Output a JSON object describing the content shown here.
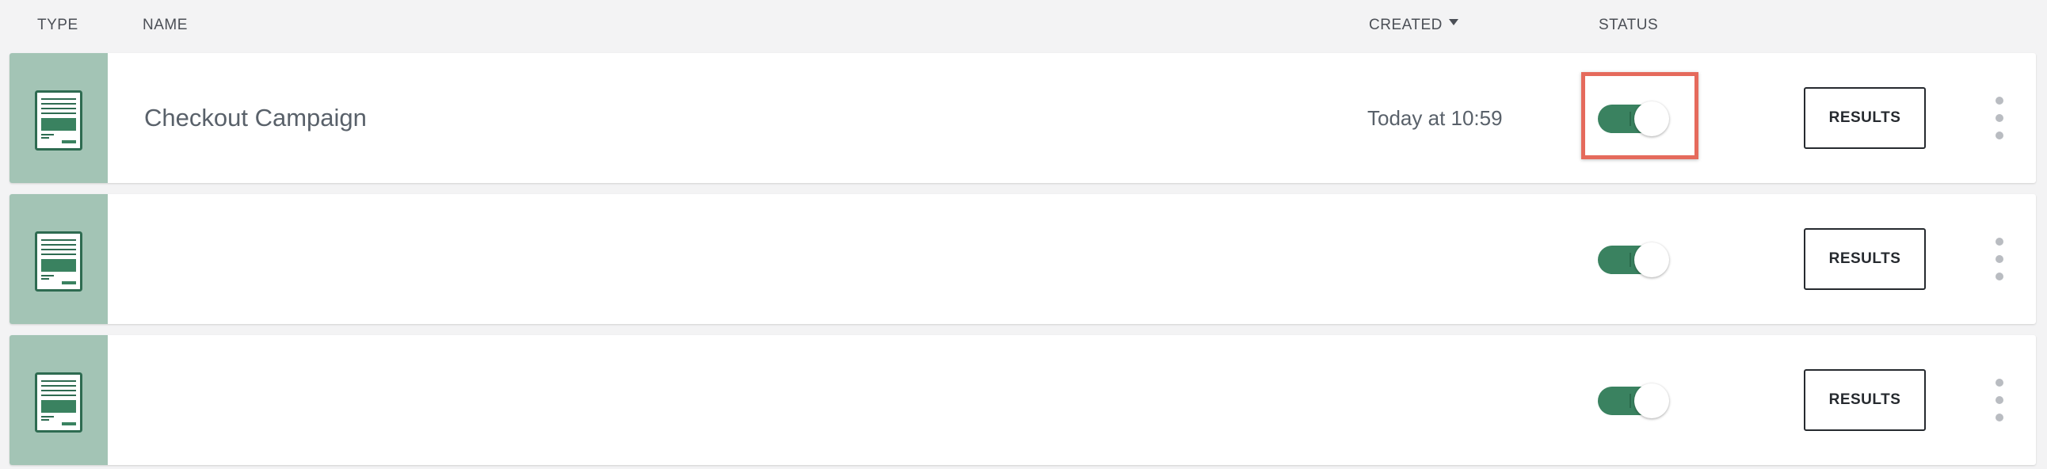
{
  "header": {
    "type_label": "TYPE",
    "name_label": "NAME",
    "created_label": "CREATED",
    "status_label": "STATUS",
    "sort_icon": "sort-desc-icon"
  },
  "rows": [
    {
      "type_icon": "form-document-icon",
      "name": "Checkout Campaign",
      "created": "Today at 10:59",
      "status_on": true,
      "results_label": "RESULTS",
      "more_icon": "more-vertical-icon"
    },
    {
      "type_icon": "form-document-icon",
      "name": "",
      "created": "",
      "status_on": true,
      "results_label": "RESULTS",
      "more_icon": "more-vertical-icon"
    },
    {
      "type_icon": "form-document-icon",
      "name": "",
      "created": "",
      "status_on": true,
      "results_label": "RESULTS",
      "more_icon": "more-vertical-icon"
    }
  ],
  "colors": {
    "background": "#f3f3f4",
    "thumb": "#a3c4b5",
    "accent_green": "#3a8260",
    "highlight": "#e56a5c",
    "text": "#59616a"
  }
}
